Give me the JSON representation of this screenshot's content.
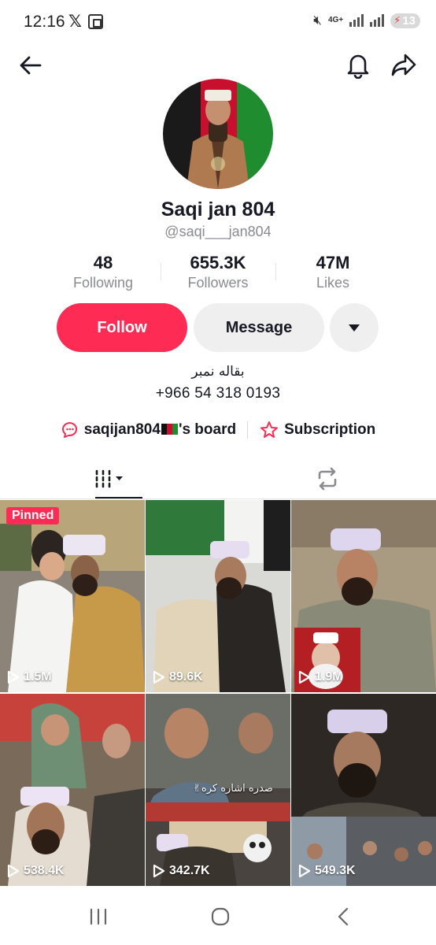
{
  "status_bar": {
    "time": "12:16",
    "x_label": "𝕏",
    "network": "4G+",
    "battery": "13"
  },
  "header": {
    "back_icon": "arrow-left-icon",
    "bell_icon": "bell-icon",
    "share_icon": "share-icon"
  },
  "profile": {
    "display_name": "Saqi jan 804",
    "username": "@saqi___jan804",
    "stats": [
      {
        "value": "48",
        "label": "Following"
      },
      {
        "value": "655.3K",
        "label": "Followers"
      },
      {
        "value": "47M",
        "label": "Likes"
      }
    ],
    "follow_label": "Follow",
    "message_label": "Message",
    "bio_line1": "بقاله نمبر",
    "bio_line2": "+966 54 318 0193",
    "board_link_prefix": "saqijan804",
    "board_link_suffix": "'s board",
    "subscription_label": "Subscription"
  },
  "tabs": {
    "videos_icon": "grid-icon",
    "reposts_icon": "repost-icon"
  },
  "videos": [
    {
      "views": "1.5M",
      "pinned_label": "Pinned"
    },
    {
      "views": "89.6K"
    },
    {
      "views": "1.9M"
    },
    {
      "views": "538.4K"
    },
    {
      "views": "342.7K",
      "overlay": "صدره اشاره کره✌"
    },
    {
      "views": "549.3K"
    }
  ],
  "colors": {
    "accent": "#fe2c55",
    "text": "#161823",
    "secondary": "#8a8b91",
    "button_gray": "#efeff0"
  }
}
